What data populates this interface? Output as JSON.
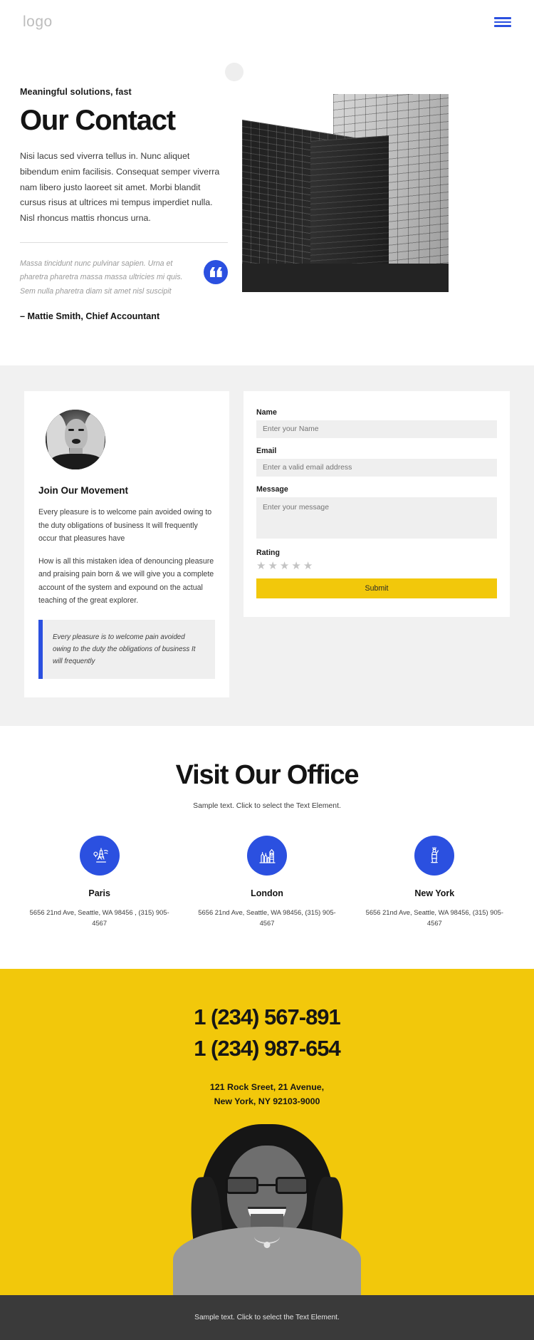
{
  "header": {
    "logo": "logo",
    "menu_icon": "hamburger-menu-icon"
  },
  "hero": {
    "eyebrow": "Meaningful solutions, fast",
    "title": "Our Contact",
    "paragraph": "Nisi lacus sed viverra tellus in. Nunc aliquet bibendum enim facilisis. Consequat semper viverra nam libero justo laoreet sit amet. Morbi blandit cursus risus at ultrices mi tempus imperdiet nulla. Nisl rhoncus mattis rhoncus urna.",
    "quote": "Massa tincidunt nunc pulvinar sapien. Urna et pharetra pharetra massa massa ultricies mi quis. Sem nulla pharetra diam sit amet nisl suscipit",
    "quote_icon": "quote-mark-icon",
    "author": "– Mattie Smith, Chief Accountant",
    "image_alt": "skyscraper-buildings-photo"
  },
  "join_card": {
    "avatar_alt": "woman-portrait-avatar",
    "title": "Join Our Movement",
    "paragraph_1": "Every pleasure is to welcome pain avoided owing to the duty obligations of business It will frequently occur that pleasures have",
    "paragraph_2": "How is all this mistaken idea of denouncing pleasure and praising pain born & we will give you a complete account of the system and expound on the actual teaching of the great explorer.",
    "blockquote": "Every pleasure is to welcome pain avoided owing to the duty the obligations of business It will frequently"
  },
  "form": {
    "fields": [
      {
        "label": "Name",
        "placeholder": "Enter your Name",
        "value": ""
      },
      {
        "label": "Email",
        "placeholder": "Enter a valid email address",
        "value": ""
      },
      {
        "label": "Message",
        "placeholder": "Enter your message",
        "value": ""
      }
    ],
    "rating_label": "Rating",
    "rating_stars": 5,
    "rating_value": 0,
    "star_glyph": "★",
    "submit_label": "Submit",
    "submit_color": "#f2c80b"
  },
  "offices": {
    "title": "Visit Our Office",
    "subtitle": "Sample text. Click to select the Text Element.",
    "accent_color": "#2b50e0",
    "items": [
      {
        "name": "Paris",
        "icon": "eiffel-tower-icon",
        "address": "5656 21nd Ave, Seattle, WA 98456 , (315) 905-4567"
      },
      {
        "name": "London",
        "icon": "big-ben-icon",
        "address": "5656 21nd Ave, Seattle, WA 98456, (315) 905-4567"
      },
      {
        "name": "New York",
        "icon": "statue-of-liberty-icon",
        "address": "5656 21nd Ave, Seattle, WA 98456, (315) 905-4567"
      }
    ]
  },
  "cta": {
    "background_color": "#f2c80b",
    "phone_1": "1 (234) 567-891",
    "phone_2": "1 (234) 987-654",
    "address_line_1": "121 Rock Sreet, 21 Avenue,",
    "address_line_2": "New York, NY 92103-9000",
    "image_alt": "smiling-woman-with-glasses-photo"
  },
  "footer": {
    "text": "Sample text. Click to select the Text Element."
  }
}
